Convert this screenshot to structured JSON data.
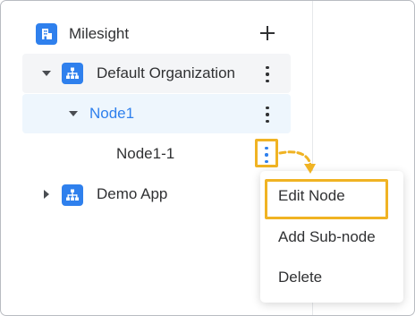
{
  "colors": {
    "accent": "#2f80ed",
    "selected_row_bg": "#eef6fd",
    "hover_row_bg": "#f4f5f7",
    "highlight": "#f0b323",
    "text": "#303133"
  },
  "tree": {
    "root": {
      "label": "Milesight",
      "icon": "building-icon",
      "add_icon": "plus-icon"
    },
    "nodes": [
      {
        "label": "Default Organization",
        "icon": "org-chart-icon",
        "expanded": true
      },
      {
        "label": "Node1",
        "expanded": true,
        "selected": true
      },
      {
        "label": "Node1-1"
      },
      {
        "label": "Demo App",
        "icon": "org-chart-icon",
        "expanded": false
      }
    ]
  },
  "context_menu": {
    "items": [
      {
        "label": "Edit Node",
        "highlighted": true
      },
      {
        "label": "Add Sub-node"
      },
      {
        "label": "Delete"
      }
    ]
  }
}
